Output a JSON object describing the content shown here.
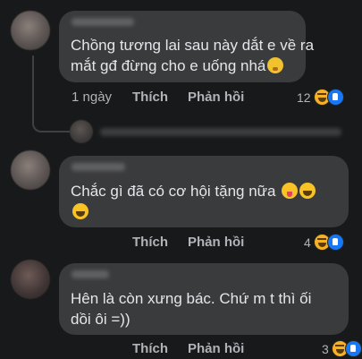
{
  "comments": [
    {
      "text_line1": "Chồng tương lai sau này dắt e về ra",
      "text_line2": "mắt gđ đừng cho e uống nhá",
      "time": "1 ngày",
      "like": "Thích",
      "reply": "Phản hồi",
      "reaction_count": "12"
    },
    {
      "text_line1": "Chắc gì đã có cơ hội tặng nữa",
      "like": "Thích",
      "reply": "Phản hồi",
      "reaction_count": "4"
    },
    {
      "text_line1": "Hên là còn xưng bác. Chứ m t thì ối",
      "text_line2": "dồi ôi =))",
      "like": "Thích",
      "reply": "Phản hồi",
      "reaction_count": "3"
    }
  ],
  "icons": {
    "reaction_haha": "haha-icon",
    "reaction_like": "like-icon"
  },
  "colors": {
    "background": "#18191a",
    "bubble": "#3a3b3c",
    "text": "#e4e6eb",
    "secondary": "#b0b3b8",
    "like_blue": "#1877f2",
    "haha_yellow": "#f7b125"
  }
}
